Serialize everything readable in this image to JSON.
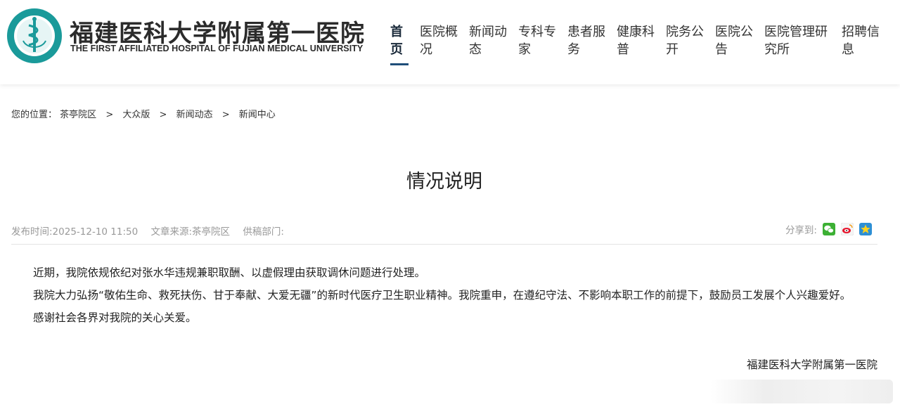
{
  "header": {
    "hospital_name_cn": "福建医科大学附属第一医院",
    "hospital_name_en": "THE FIRST AFFILIATED HOSPITAL OF FUJIAN MEDICAL UNIVERSITY",
    "nav": [
      {
        "line1": "首",
        "line2": "页"
      },
      {
        "line1": "医院概",
        "line2": "况"
      },
      {
        "line1": "新闻动",
        "line2": "态"
      },
      {
        "line1": "专科专",
        "line2": "家"
      },
      {
        "line1": "患者服",
        "line2": "务"
      },
      {
        "line1": "健康科",
        "line2": "普"
      },
      {
        "line1": "院务公",
        "line2": "开"
      },
      {
        "line1": "医院公",
        "line2": "告"
      },
      {
        "line1": "医院管理研",
        "line2": "究所"
      },
      {
        "line1": "招聘信",
        "line2": "息"
      }
    ]
  },
  "breadcrumb": {
    "label": "您的位置：",
    "items": [
      "茶亭院区",
      "大众版",
      "新闻动态",
      "新闻中心"
    ],
    "separator": ">"
  },
  "article": {
    "title": "情况说明",
    "publish_time": "发布时间:2025-12-10 11:50",
    "source": "文章来源:茶亭院区",
    "department": "供稿部门:",
    "share_label": "分享到:",
    "share_icons": [
      "wechat-icon",
      "weibo-icon",
      "qzone-icon"
    ],
    "paragraphs": [
      "近期，我院依规依纪对张水华违规兼职取酬、以虚假理由获取调休问题进行处理。",
      "我院大力弘扬“敬佑生命、救死扶伤、甘于奉献、大爱无疆”的新时代医疗卫生职业精神。我院重申，在遵纪守法、不影响本职工作的前提下，鼓励员工发展个人兴趣爱好。",
      "感谢社会各界对我院的关心关爱。"
    ],
    "signature": "福建医科大学附属第一医院"
  },
  "colors": {
    "nav_active_underline": "#1f4e79",
    "logo_teal": "#1a9a9a",
    "meta_gray": "#999999"
  }
}
